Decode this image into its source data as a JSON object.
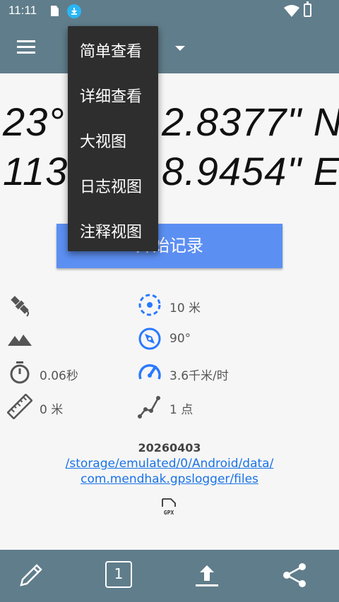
{
  "status_bar": {
    "time": "11:11"
  },
  "coordinates": {
    "lat_left": "23°",
    "lat_right": "2.8377\" N",
    "lon_left": "113",
    "lon_right": "8.9454\" E"
  },
  "start_button": {
    "label": "开始记录"
  },
  "stats": {
    "accuracy": "10 米",
    "direction": "90°",
    "duration": "0.06秒",
    "speed": "3.6千米/时",
    "distance": "0 米",
    "points": "1 点"
  },
  "file": {
    "date": "20260403",
    "path_line1": "/storage/emulated/0/Android/data/",
    "path_line2": "com.mendhak.gpslogger/files",
    "format_icon": "gpx-file-icon",
    "format_label": "GPX"
  },
  "bottom_bar": {
    "annotation_count": "1"
  },
  "view_menu": {
    "items": [
      "简单查看",
      "详细查看",
      "大视图",
      "日志视图",
      "注释视图"
    ]
  },
  "colors": {
    "toolbar": "#607d8b",
    "accent": "#5c8ff2",
    "icon_blue": "#2979ff",
    "link": "#1a73e8",
    "menu_bg": "#2e2e2e"
  }
}
